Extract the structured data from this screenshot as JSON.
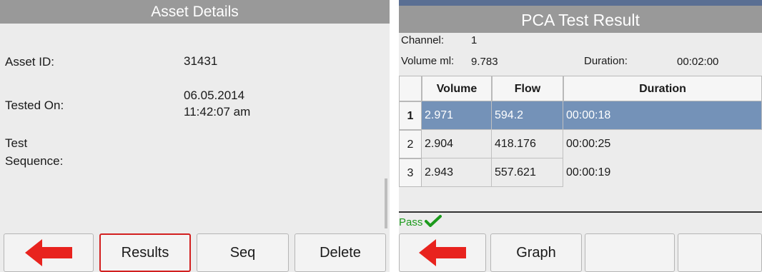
{
  "asset": {
    "title": "Asset Details",
    "fields": [
      {
        "label": "Asset ID:",
        "value": "31431"
      },
      {
        "label": "Tested On:",
        "value_line1": "06.05.2014",
        "value_line2": "11:42:07 am"
      },
      {
        "label_line1": "Test",
        "label_line2": "Sequence:"
      }
    ],
    "buttons": [
      {
        "icon": "back-arrow-icon"
      },
      {
        "label": "Results"
      },
      {
        "label": "Seq"
      },
      {
        "label": "Delete"
      }
    ]
  },
  "result": {
    "title": "PCA Test Result",
    "channel_label": "Channel:",
    "channel_value": "1",
    "volume_label": "Volume ml:",
    "volume_value": "9.783",
    "duration_label": "Duration:",
    "duration_value": "00:02:00",
    "columns": [
      "Volume",
      "Flow",
      "Duration"
    ],
    "rows": [
      {
        "num": "1",
        "volume": "2.971",
        "flow": "594.2",
        "duration": "00:00:18"
      },
      {
        "num": "2",
        "volume": "2.904",
        "flow": "418.176",
        "duration": "00:00:25"
      },
      {
        "num": "3",
        "volume": "2.943",
        "flow": "557.621",
        "duration": "00:00:19"
      }
    ],
    "status": "Pass",
    "status_icon": "check-icon",
    "buttons": [
      {
        "icon": "back-arrow-icon"
      },
      {
        "label": "Graph"
      },
      {
        "label": ""
      },
      {
        "label": ""
      }
    ]
  },
  "colors": {
    "arrow": "#e8231e",
    "selection": "#7492b8",
    "selected_border": "#d21f1f",
    "pass": "#1c9a1c"
  }
}
